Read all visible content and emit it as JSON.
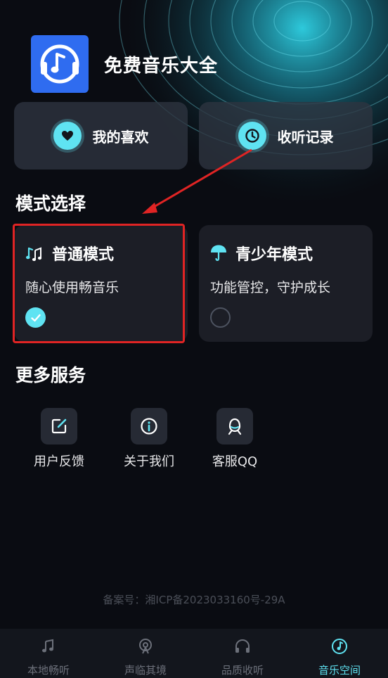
{
  "app": {
    "title": "免费音乐大全"
  },
  "quick_actions": [
    {
      "label": "我的喜欢",
      "icon": "heart-icon"
    },
    {
      "label": "收听记录",
      "icon": "clock-icon"
    }
  ],
  "mode_section": {
    "title": "模式选择",
    "modes": [
      {
        "title": "普通模式",
        "desc": "随心使用畅音乐",
        "selected": true,
        "icon": "music-note-icon"
      },
      {
        "title": "青少年模式",
        "desc": "功能管控，守护成长",
        "selected": false,
        "icon": "umbrella-icon"
      }
    ]
  },
  "services_section": {
    "title": "更多服务",
    "items": [
      {
        "label": "用户反馈",
        "icon": "edit-icon"
      },
      {
        "label": "关于我们",
        "icon": "info-icon"
      },
      {
        "label": "客服QQ",
        "icon": "qq-icon"
      }
    ]
  },
  "footer": {
    "icp": "备案号：湘ICP备2023033160号-29A"
  },
  "tabs": [
    {
      "label": "本地畅听",
      "icon": "music-file-icon",
      "active": false
    },
    {
      "label": "声临其境",
      "icon": "broadcast-icon",
      "active": false
    },
    {
      "label": "品质收听",
      "icon": "headphones-icon",
      "active": false
    },
    {
      "label": "音乐空间",
      "icon": "disc-icon",
      "active": true
    }
  ],
  "colors": {
    "accent": "#5fe3f2",
    "background": "#0a0c12",
    "card": "#1c1e26",
    "highlight": "#e02424",
    "logo": "#2f6cf0"
  }
}
